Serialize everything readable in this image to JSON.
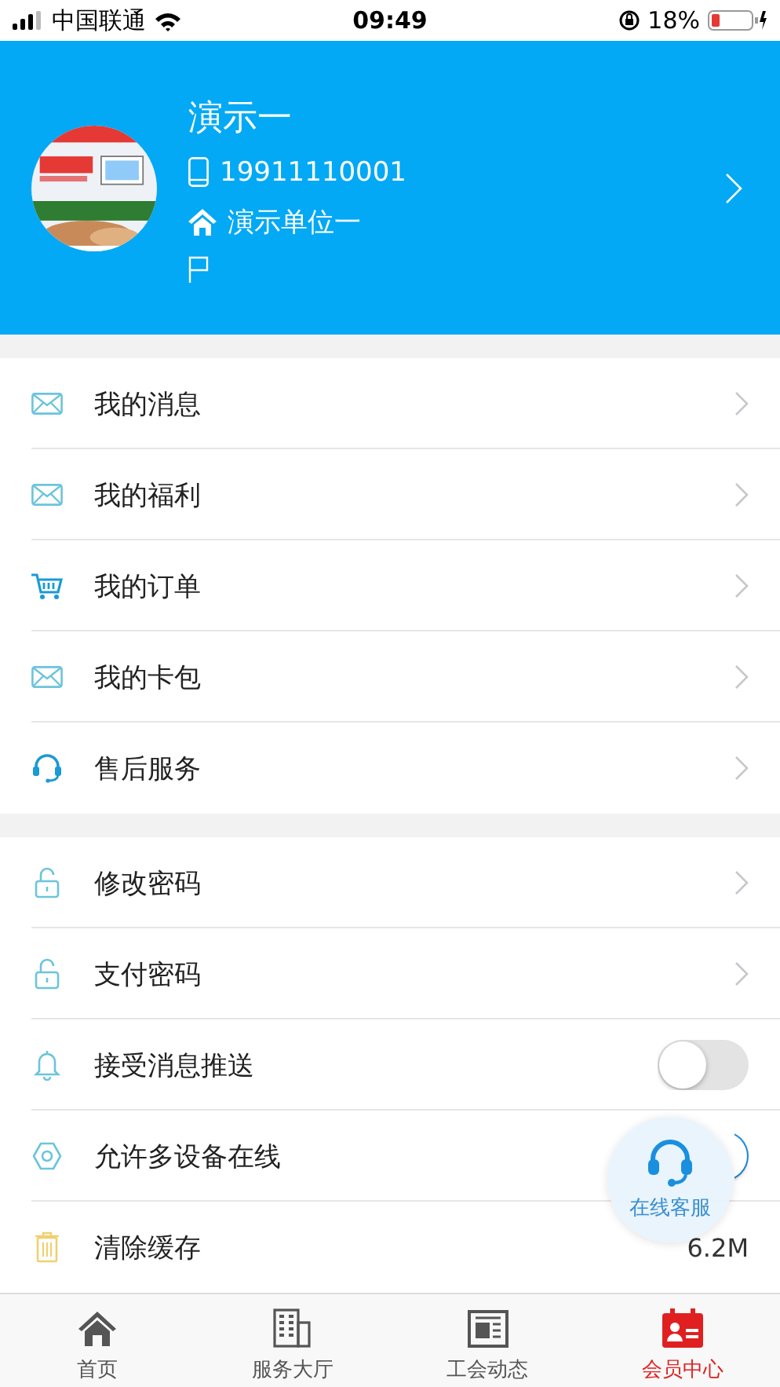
{
  "status_bar": {
    "carrier": "中国联通",
    "time": "09:49",
    "battery": "18%"
  },
  "profile": {
    "name": "演示一",
    "phone": "19911110001",
    "unit": "演示单位一"
  },
  "sections": [
    {
      "items": [
        {
          "label": "我的消息",
          "kind": "link"
        },
        {
          "label": "我的福利",
          "kind": "link"
        },
        {
          "label": "我的订单",
          "kind": "link"
        },
        {
          "label": "我的卡包",
          "kind": "link"
        },
        {
          "label": "售后服务",
          "kind": "link"
        }
      ]
    },
    {
      "items": [
        {
          "label": "修改密码",
          "kind": "link"
        },
        {
          "label": "支付密码",
          "kind": "link"
        },
        {
          "label": "接受消息推送",
          "kind": "toggle",
          "on": false
        },
        {
          "label": "允许多设备在线",
          "kind": "toggle",
          "on": true
        },
        {
          "label": "清除缓存",
          "kind": "value",
          "value": "6.2M"
        }
      ]
    }
  ],
  "floating_button": {
    "label": "在线客服"
  },
  "tabs": [
    {
      "label": "首页",
      "selected": false
    },
    {
      "label": "服务大厅",
      "selected": false
    },
    {
      "label": "工会动态",
      "selected": false
    },
    {
      "label": "会员中心",
      "selected": true
    }
  ]
}
